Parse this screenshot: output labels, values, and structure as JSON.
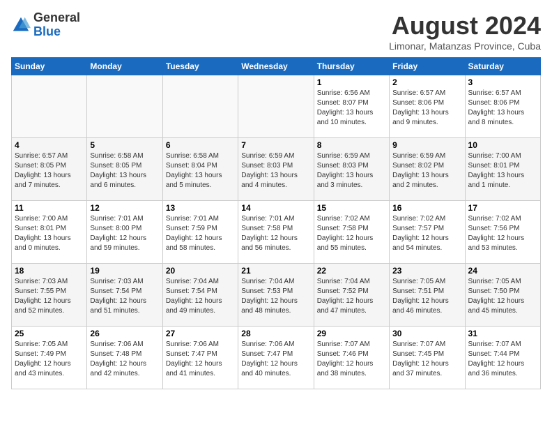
{
  "header": {
    "logo_general": "General",
    "logo_blue": "Blue",
    "month_year": "August 2024",
    "location": "Limonar, Matanzas Province, Cuba"
  },
  "days_of_week": [
    "Sunday",
    "Monday",
    "Tuesday",
    "Wednesday",
    "Thursday",
    "Friday",
    "Saturday"
  ],
  "weeks": [
    [
      {
        "day": "",
        "info": ""
      },
      {
        "day": "",
        "info": ""
      },
      {
        "day": "",
        "info": ""
      },
      {
        "day": "",
        "info": ""
      },
      {
        "day": "1",
        "info": "Sunrise: 6:56 AM\nSunset: 8:07 PM\nDaylight: 13 hours and 10 minutes."
      },
      {
        "day": "2",
        "info": "Sunrise: 6:57 AM\nSunset: 8:06 PM\nDaylight: 13 hours and 9 minutes."
      },
      {
        "day": "3",
        "info": "Sunrise: 6:57 AM\nSunset: 8:06 PM\nDaylight: 13 hours and 8 minutes."
      }
    ],
    [
      {
        "day": "4",
        "info": "Sunrise: 6:57 AM\nSunset: 8:05 PM\nDaylight: 13 hours and 7 minutes."
      },
      {
        "day": "5",
        "info": "Sunrise: 6:58 AM\nSunset: 8:05 PM\nDaylight: 13 hours and 6 minutes."
      },
      {
        "day": "6",
        "info": "Sunrise: 6:58 AM\nSunset: 8:04 PM\nDaylight: 13 hours and 5 minutes."
      },
      {
        "day": "7",
        "info": "Sunrise: 6:59 AM\nSunset: 8:03 PM\nDaylight: 13 hours and 4 minutes."
      },
      {
        "day": "8",
        "info": "Sunrise: 6:59 AM\nSunset: 8:03 PM\nDaylight: 13 hours and 3 minutes."
      },
      {
        "day": "9",
        "info": "Sunrise: 6:59 AM\nSunset: 8:02 PM\nDaylight: 13 hours and 2 minutes."
      },
      {
        "day": "10",
        "info": "Sunrise: 7:00 AM\nSunset: 8:01 PM\nDaylight: 13 hours and 1 minute."
      }
    ],
    [
      {
        "day": "11",
        "info": "Sunrise: 7:00 AM\nSunset: 8:01 PM\nDaylight: 13 hours and 0 minutes."
      },
      {
        "day": "12",
        "info": "Sunrise: 7:01 AM\nSunset: 8:00 PM\nDaylight: 12 hours and 59 minutes."
      },
      {
        "day": "13",
        "info": "Sunrise: 7:01 AM\nSunset: 7:59 PM\nDaylight: 12 hours and 58 minutes."
      },
      {
        "day": "14",
        "info": "Sunrise: 7:01 AM\nSunset: 7:58 PM\nDaylight: 12 hours and 56 minutes."
      },
      {
        "day": "15",
        "info": "Sunrise: 7:02 AM\nSunset: 7:58 PM\nDaylight: 12 hours and 55 minutes."
      },
      {
        "day": "16",
        "info": "Sunrise: 7:02 AM\nSunset: 7:57 PM\nDaylight: 12 hours and 54 minutes."
      },
      {
        "day": "17",
        "info": "Sunrise: 7:02 AM\nSunset: 7:56 PM\nDaylight: 12 hours and 53 minutes."
      }
    ],
    [
      {
        "day": "18",
        "info": "Sunrise: 7:03 AM\nSunset: 7:55 PM\nDaylight: 12 hours and 52 minutes."
      },
      {
        "day": "19",
        "info": "Sunrise: 7:03 AM\nSunset: 7:54 PM\nDaylight: 12 hours and 51 minutes."
      },
      {
        "day": "20",
        "info": "Sunrise: 7:04 AM\nSunset: 7:54 PM\nDaylight: 12 hours and 49 minutes."
      },
      {
        "day": "21",
        "info": "Sunrise: 7:04 AM\nSunset: 7:53 PM\nDaylight: 12 hours and 48 minutes."
      },
      {
        "day": "22",
        "info": "Sunrise: 7:04 AM\nSunset: 7:52 PM\nDaylight: 12 hours and 47 minutes."
      },
      {
        "day": "23",
        "info": "Sunrise: 7:05 AM\nSunset: 7:51 PM\nDaylight: 12 hours and 46 minutes."
      },
      {
        "day": "24",
        "info": "Sunrise: 7:05 AM\nSunset: 7:50 PM\nDaylight: 12 hours and 45 minutes."
      }
    ],
    [
      {
        "day": "25",
        "info": "Sunrise: 7:05 AM\nSunset: 7:49 PM\nDaylight: 12 hours and 43 minutes."
      },
      {
        "day": "26",
        "info": "Sunrise: 7:06 AM\nSunset: 7:48 PM\nDaylight: 12 hours and 42 minutes."
      },
      {
        "day": "27",
        "info": "Sunrise: 7:06 AM\nSunset: 7:47 PM\nDaylight: 12 hours and 41 minutes."
      },
      {
        "day": "28",
        "info": "Sunrise: 7:06 AM\nSunset: 7:47 PM\nDaylight: 12 hours and 40 minutes."
      },
      {
        "day": "29",
        "info": "Sunrise: 7:07 AM\nSunset: 7:46 PM\nDaylight: 12 hours and 38 minutes."
      },
      {
        "day": "30",
        "info": "Sunrise: 7:07 AM\nSunset: 7:45 PM\nDaylight: 12 hours and 37 minutes."
      },
      {
        "day": "31",
        "info": "Sunrise: 7:07 AM\nSunset: 7:44 PM\nDaylight: 12 hours and 36 minutes."
      }
    ]
  ]
}
